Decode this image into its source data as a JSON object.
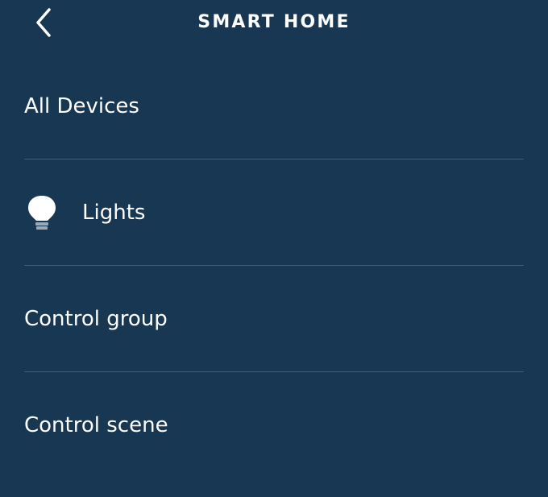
{
  "header": {
    "title": "SMART HOME",
    "back_icon": "chevron-left-icon"
  },
  "list": {
    "items": [
      {
        "label": "All Devices",
        "icon": null
      },
      {
        "label": "Lights",
        "icon": "light-bulb-icon"
      },
      {
        "label": "Control group",
        "icon": null
      },
      {
        "label": "Control scene",
        "icon": null
      }
    ]
  },
  "colors": {
    "background": "#173753",
    "divider": "#3b5d7c",
    "text": "#ffffff",
    "icon_light": "#ffffff",
    "icon_base": "#9aa9b8"
  }
}
